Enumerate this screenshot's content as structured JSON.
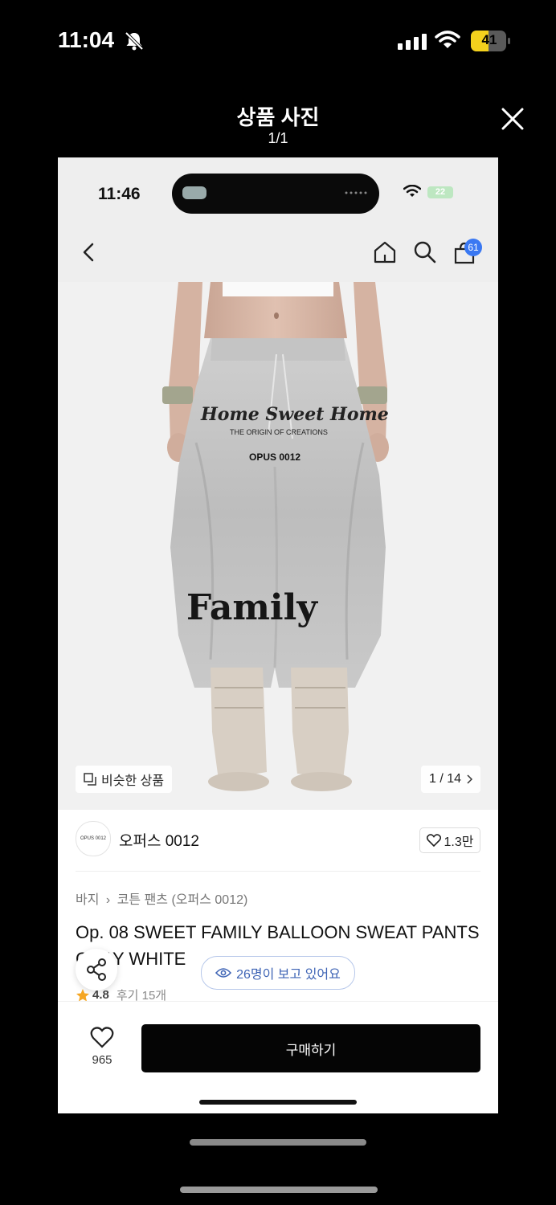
{
  "status_bar": {
    "time": "11:04",
    "battery": "41"
  },
  "viewer": {
    "title": "상품 사진",
    "counter": "1/1"
  },
  "photo": {
    "status_time": "11:46",
    "status_battery": "22",
    "cart_count": "61",
    "similar_label": "비슷한 상품",
    "image_page": "1 / 14",
    "print_texts": [
      "Home Sweet Home",
      "THE ORIGIN OF CREATIONS",
      "OPUS 0012",
      "Family"
    ],
    "brand": {
      "logo_text": "OPUS 0012",
      "name": "오퍼스 0012",
      "likes": "1.3만"
    },
    "breadcrumb": {
      "category": "바지",
      "sub": "코튼 팬츠 (오퍼스 0012)"
    },
    "title": "Op. 08 SWEET FAMILY BALLOON SWEAT PANTS GRAY WHITE",
    "viewers": "26명이 보고 있어요",
    "rating": {
      "score": "4.8",
      "reviews": "후기 15개"
    },
    "wish_count": "965",
    "buy_label": "구매하기"
  },
  "colors": {
    "accent_blue": "#3a78f2",
    "viewer_pill": "#3e64b5",
    "star": "#f5a623"
  }
}
